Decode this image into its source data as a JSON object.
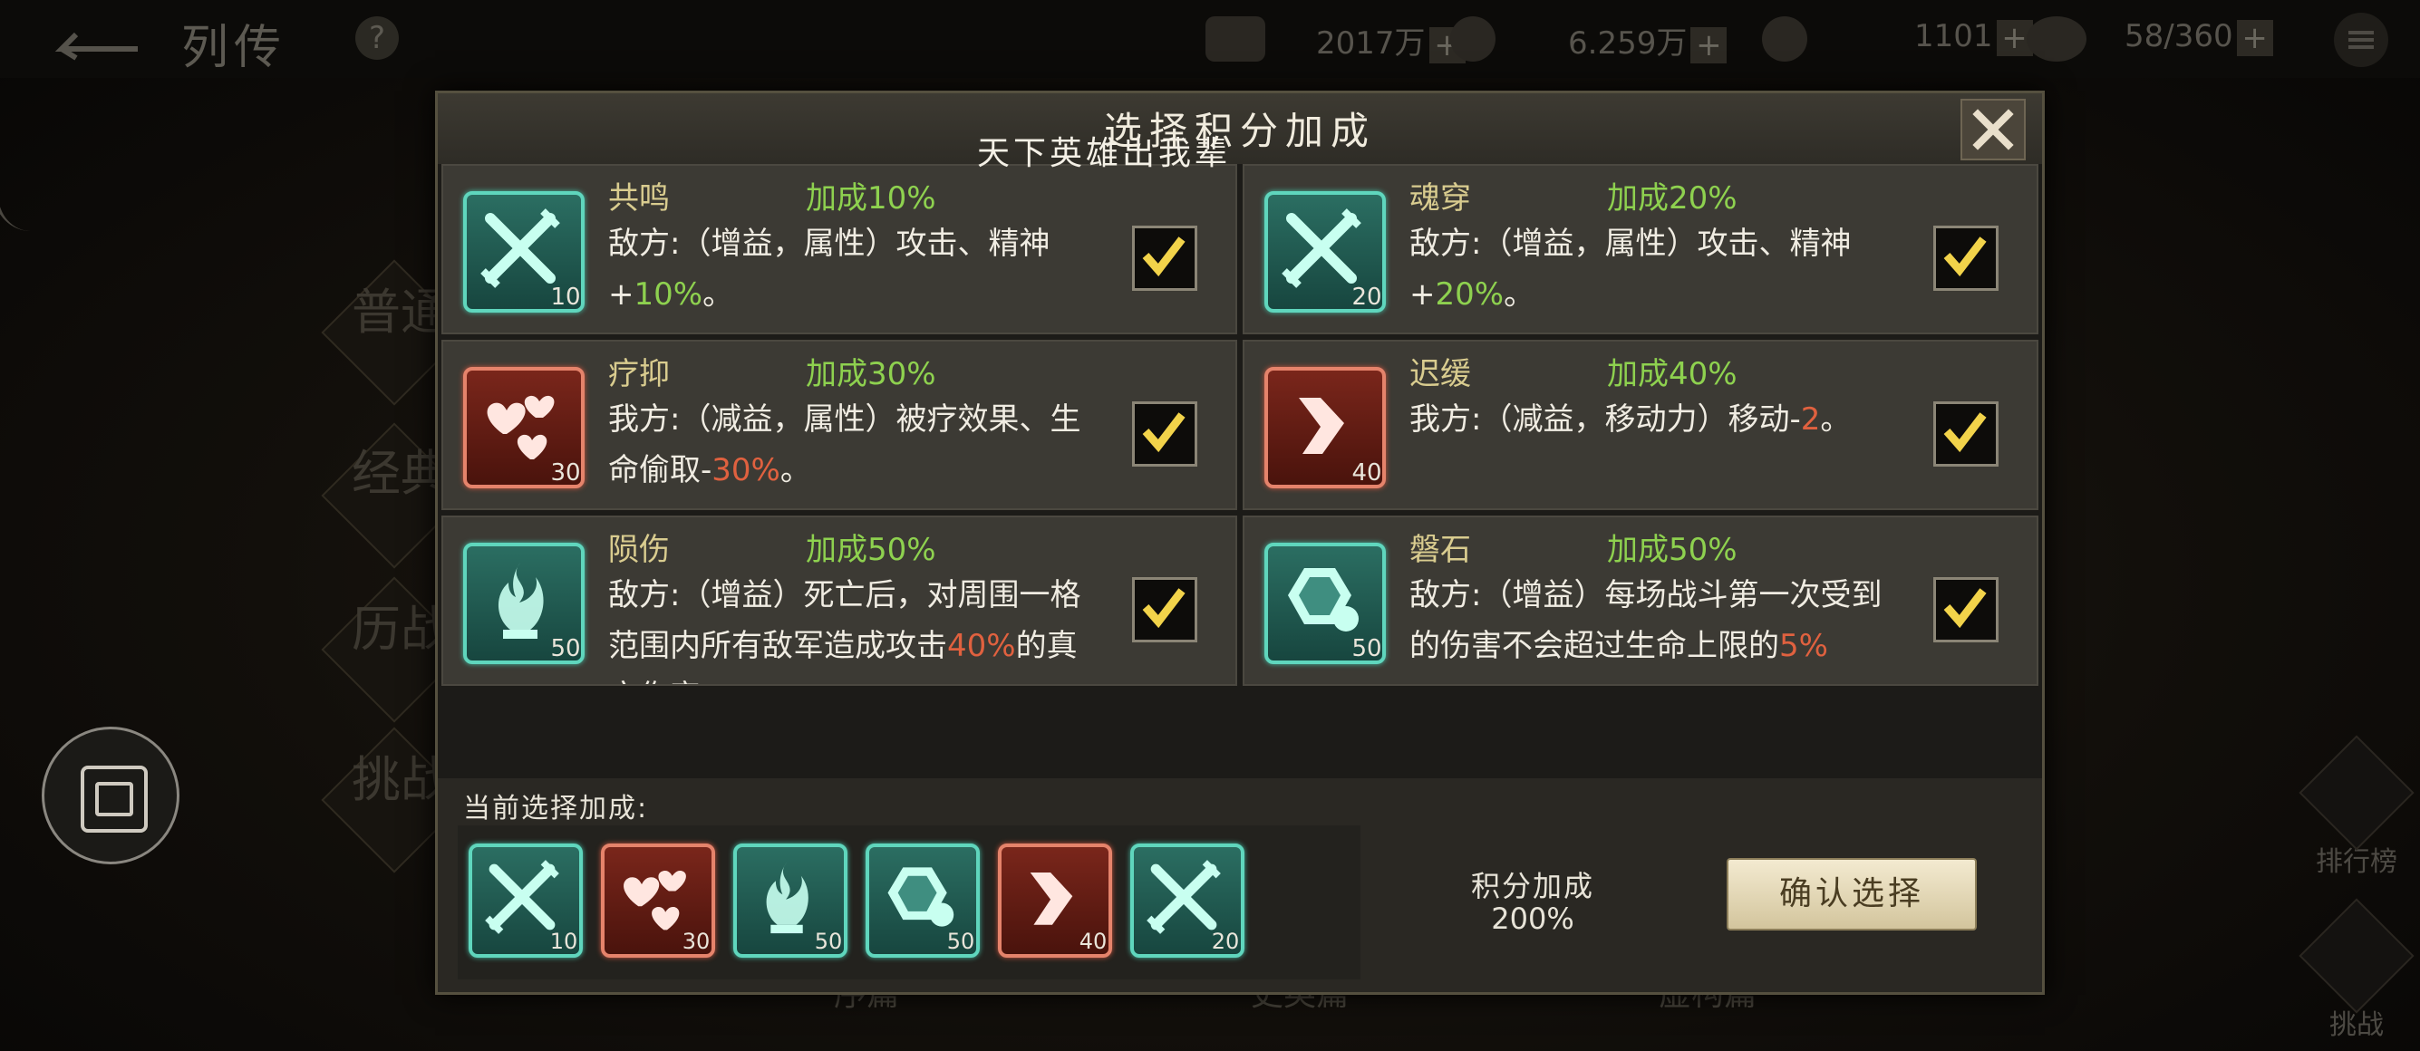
{
  "top": {
    "title": "列传",
    "resources": [
      {
        "value": "2017万"
      },
      {
        "value": "6.259万"
      },
      {
        "value": "1101"
      },
      {
        "value": "58/360"
      }
    ]
  },
  "left_side": [
    "普通",
    "经典",
    "历战",
    "挑战"
  ],
  "right_side": [
    {
      "label": "排行榜"
    },
    {
      "label": "挑战"
    }
  ],
  "bottom_tabs": [
    "序篇",
    "史英篇",
    "虚构篇"
  ],
  "dialog": {
    "title": "选择积分加成",
    "banner": "天下英雄出我辈",
    "cards": [
      {
        "name": "共鸣",
        "bonus": "加成10%",
        "desc_a": "敌方:（增益，属性）攻击、精神+",
        "desc_hl": "10%",
        "desc_b": "。",
        "level": "10",
        "icon": "swords-icon",
        "theme": "green",
        "checked": true
      },
      {
        "name": "魂穿",
        "bonus": "加成20%",
        "desc_a": "敌方:（增益，属性）攻击、精神+",
        "desc_hl": "20%",
        "desc_b": "。",
        "level": "20",
        "icon": "swords-icon",
        "theme": "green",
        "checked": true
      },
      {
        "name": "疗抑",
        "bonus": "加成30%",
        "desc_a": "我方:（减益，属性）被疗效果、生命偷取-",
        "desc_hl": "30%",
        "desc_b": "。",
        "level": "30",
        "icon": "hearts-icon",
        "theme": "red",
        "checked": true
      },
      {
        "name": "迟缓",
        "bonus": "加成40%",
        "desc_a": "我方:（减益，移动力）移动-",
        "desc_hl": "2",
        "desc_b": "。",
        "level": "40",
        "icon": "boot-icon",
        "theme": "red",
        "checked": true
      },
      {
        "name": "陨伤",
        "bonus": "加成50%",
        "desc_a": "敌方:（增益）死亡后，对周围一格范围内所有敌军造成攻击",
        "desc_hl": "40%",
        "desc_b": "的真实伤害",
        "level": "50",
        "icon": "ghost-flame-icon",
        "theme": "green",
        "checked": true
      },
      {
        "name": "磐石",
        "bonus": "加成50%",
        "desc_a": "敌方:（增益）每场战斗第一次受到的伤害不会超过生命上限的",
        "desc_hl": "5%",
        "desc_b": "",
        "level": "50",
        "icon": "shield-icon",
        "theme": "green",
        "checked": true
      }
    ],
    "current_label": "当前选择加成:",
    "current": [
      {
        "icon": "swords-icon",
        "theme": "green",
        "level": "10"
      },
      {
        "icon": "hearts-icon",
        "theme": "red",
        "level": "30"
      },
      {
        "icon": "ghost-flame-icon",
        "theme": "green",
        "level": "50"
      },
      {
        "icon": "shield-icon",
        "theme": "green",
        "level": "50"
      },
      {
        "icon": "boot-icon",
        "theme": "red",
        "level": "40"
      },
      {
        "icon": "swords-icon",
        "theme": "green",
        "level": "20"
      }
    ],
    "score_label": "积分加成",
    "score_value": "200%",
    "confirm_label": "确认选择"
  },
  "colors": {
    "bonus_green": "#8ed14f",
    "highlight_red": "#e0613f",
    "name_gold": "#d9cc8f"
  }
}
